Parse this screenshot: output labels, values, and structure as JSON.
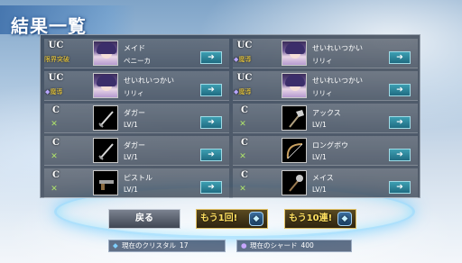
{
  "header": {
    "title": "結果一覧"
  },
  "results": [
    {
      "rarity": "UC",
      "kind": "char",
      "status": "限界突破",
      "status_type": "limit",
      "name": "メイド",
      "sub": "ペニーカ"
    },
    {
      "rarity": "UC",
      "kind": "char",
      "status": "魔導",
      "status_type": "gem",
      "name": "せいれいつかい",
      "sub": "リリィ"
    },
    {
      "rarity": "UC",
      "kind": "char",
      "status": "魔導",
      "status_type": "gem",
      "name": "せいれいつかい",
      "sub": "リリィ"
    },
    {
      "rarity": "UC",
      "kind": "char",
      "status": "魔導",
      "status_type": "gem",
      "name": "せいれいつかい",
      "sub": "リリィ"
    },
    {
      "rarity": "C",
      "kind": "item",
      "icon": "dagger-icon",
      "name": "ダガー",
      "sub": "LV/1"
    },
    {
      "rarity": "C",
      "kind": "item",
      "icon": "axe-icon",
      "name": "アックス",
      "sub": "LV/1"
    },
    {
      "rarity": "C",
      "kind": "item",
      "icon": "dagger-icon",
      "name": "ダガー",
      "sub": "LV/1"
    },
    {
      "rarity": "C",
      "kind": "item",
      "icon": "longbow-icon",
      "name": "ロングボウ",
      "sub": "LV/1"
    },
    {
      "rarity": "C",
      "kind": "item",
      "icon": "pistol-icon",
      "name": "ピストル",
      "sub": "LV/1"
    },
    {
      "rarity": "C",
      "kind": "item",
      "icon": "mace-icon",
      "name": "メイス",
      "sub": "LV/1"
    }
  ],
  "row_button_glyph": "➔",
  "buttons": {
    "back": "戻る",
    "once": "もう1回!",
    "ten": "もう10連!"
  },
  "footer": {
    "crystal_label": "現在のクリスタル",
    "crystal_value": "17",
    "shard_label": "現在のシャード",
    "shard_value": "400"
  }
}
